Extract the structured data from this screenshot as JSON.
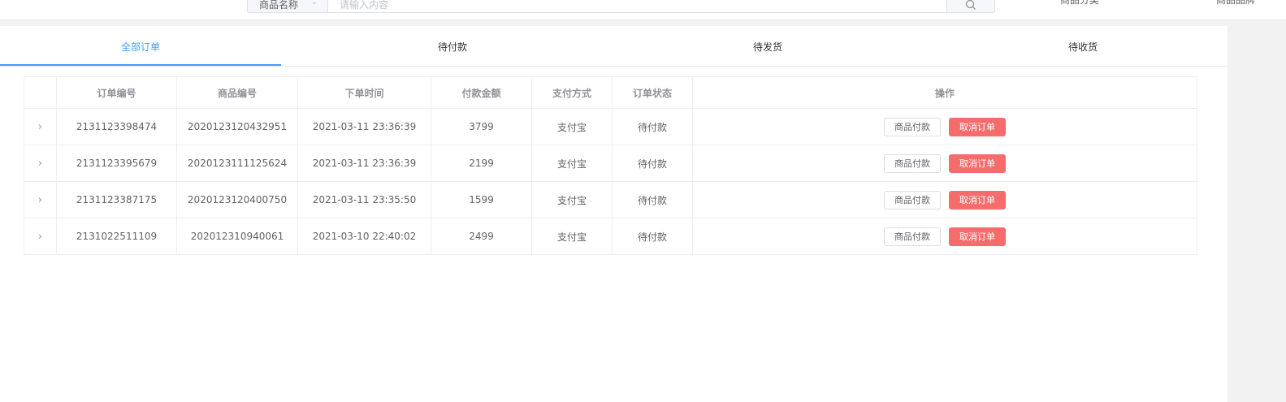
{
  "header": {
    "search_select_label": "商品名称",
    "search_placeholder": "请输入内容",
    "nav_category": "商品分类",
    "nav_brand": "商品品牌"
  },
  "tabs": [
    {
      "label": "全部订单",
      "active": true
    },
    {
      "label": "待付款",
      "active": false
    },
    {
      "label": "待发货",
      "active": false
    },
    {
      "label": "待收货",
      "active": false
    }
  ],
  "table": {
    "columns": [
      "",
      "订单编号",
      "商品编号",
      "下单时间",
      "付款金额",
      "支付方式",
      "订单状态",
      "操作"
    ],
    "pay_label": "商品付款",
    "cancel_label": "取消订单",
    "rows": [
      {
        "order_no": "2131123398474",
        "product_no": "2020123120432951",
        "time": "2021-03-11 23:36:39",
        "amount": "3799",
        "method": "支付宝",
        "status": "待付款"
      },
      {
        "order_no": "2131123395679",
        "product_no": "2020123111125624",
        "time": "2021-03-11 23:36:39",
        "amount": "2199",
        "method": "支付宝",
        "status": "待付款"
      },
      {
        "order_no": "2131123387175",
        "product_no": "2020123120400750",
        "time": "2021-03-11 23:35:50",
        "amount": "1599",
        "method": "支付宝",
        "status": "待付款"
      },
      {
        "order_no": "2131022511109",
        "product_no": "202012310940061",
        "time": "2021-03-10 22:40:02",
        "amount": "2499",
        "method": "支付宝",
        "status": "待付款"
      }
    ]
  },
  "colors": {
    "accent": "#409eff",
    "danger": "#f56c6c"
  }
}
